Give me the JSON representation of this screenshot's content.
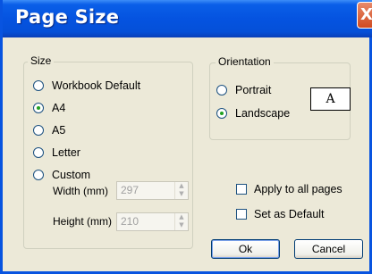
{
  "window": {
    "title": "Page Size",
    "close_glyph": "X"
  },
  "size_group": {
    "legend": "Size",
    "options": [
      {
        "label": "Workbook Default",
        "checked": false
      },
      {
        "label": "A4",
        "checked": true
      },
      {
        "label": "A5",
        "checked": false
      },
      {
        "label": "Letter",
        "checked": false
      },
      {
        "label": "Custom",
        "checked": false
      }
    ],
    "width_label": "Width (mm)",
    "width_value": "297",
    "height_label": "Height (mm)",
    "height_value": "210"
  },
  "orientation_group": {
    "legend": "Orientation",
    "options": [
      {
        "label": "Portrait",
        "checked": false
      },
      {
        "label": "Landscape",
        "checked": true
      }
    ],
    "preview_letter": "A"
  },
  "checkboxes": {
    "apply_all": "Apply to all pages",
    "set_default": "Set as Default"
  },
  "buttons": {
    "ok": "Ok",
    "cancel": "Cancel"
  }
}
